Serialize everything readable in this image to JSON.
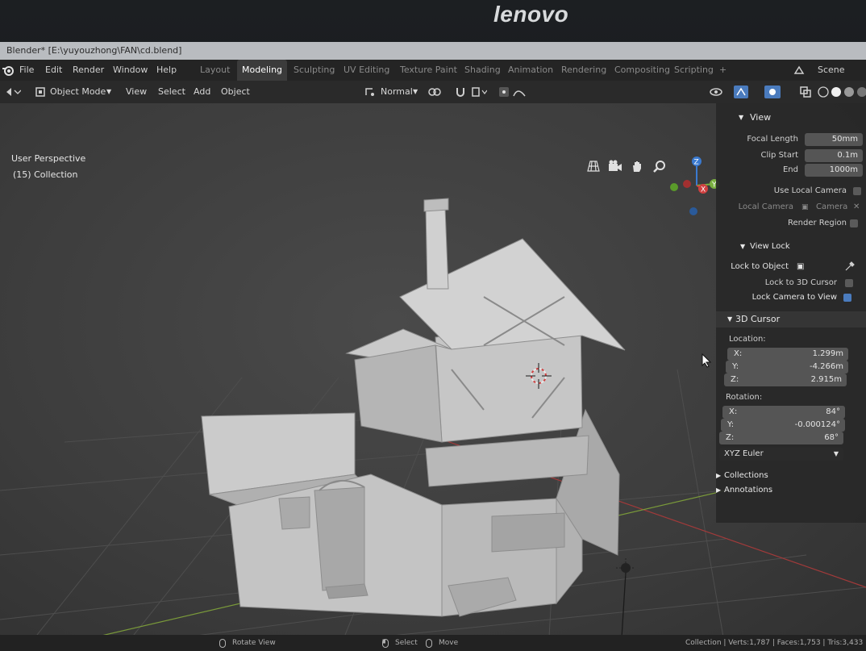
{
  "monitor": {
    "brand": "lenovo"
  },
  "window": {
    "title": "Blender* [E:\\yuyouzhong\\FAN\\cd.blend]"
  },
  "menu": {
    "file": "File",
    "edit": "Edit",
    "render": "Render",
    "window": "Window",
    "help": "Help"
  },
  "workspaces": [
    "Layout",
    "Modeling",
    "Sculpting",
    "UV Editing",
    "Texture Paint",
    "Shading",
    "Animation",
    "Rendering",
    "Compositing",
    "Scripting",
    "+"
  ],
  "scene_label": "Scene",
  "toolbar": {
    "mode": "Object Mode",
    "view": "View",
    "select": "Select",
    "add": "Add",
    "object": "Object",
    "orientation": "Normal"
  },
  "viewport": {
    "perspective": "User Perspective",
    "collection": "(15) Collection"
  },
  "gizmo": {
    "z": "Z",
    "x": "X",
    "y": "Y"
  },
  "npanel": {
    "view_header": "View",
    "focal_length_label": "Focal Length",
    "focal_length": "50mm",
    "clip_start_label": "Clip Start",
    "clip_start": "0.1m",
    "end_label": "End",
    "end": "1000m",
    "use_local_camera": "Use Local Camera",
    "local_camera_label": "Local Camera",
    "local_camera_value": "Camera",
    "render_region": "Render Region",
    "view_lock_header": "View Lock",
    "lock_to_object": "Lock to Object",
    "lock_to_3d_cursor": "Lock to 3D Cursor",
    "lock_camera_to_view": "Lock Camera to View",
    "cursor_header": "3D Cursor",
    "location_label": "Location:",
    "loc": [
      {
        "axis": "X:",
        "value": "1.299m"
      },
      {
        "axis": "Y:",
        "value": "-4.266m"
      },
      {
        "axis": "Z:",
        "value": "2.915m"
      }
    ],
    "rotation_label": "Rotation:",
    "rot": [
      {
        "axis": "X:",
        "value": "84°"
      },
      {
        "axis": "Y:",
        "value": "-0.000124°"
      },
      {
        "axis": "Z:",
        "value": "68°"
      }
    ],
    "rotation_mode": "XYZ Euler",
    "collections": "Collections",
    "annotations": "Annotations"
  },
  "status": {
    "rotate_view": "Rotate View",
    "select": "Select",
    "move": "Move",
    "stats": "Collection | Verts:1,787 | Faces:1,753 | Tris:3,433 | Obje"
  },
  "colors": {
    "accent": "#4a7bbd",
    "header": "#242424",
    "viewport": "#3d3d3d"
  }
}
